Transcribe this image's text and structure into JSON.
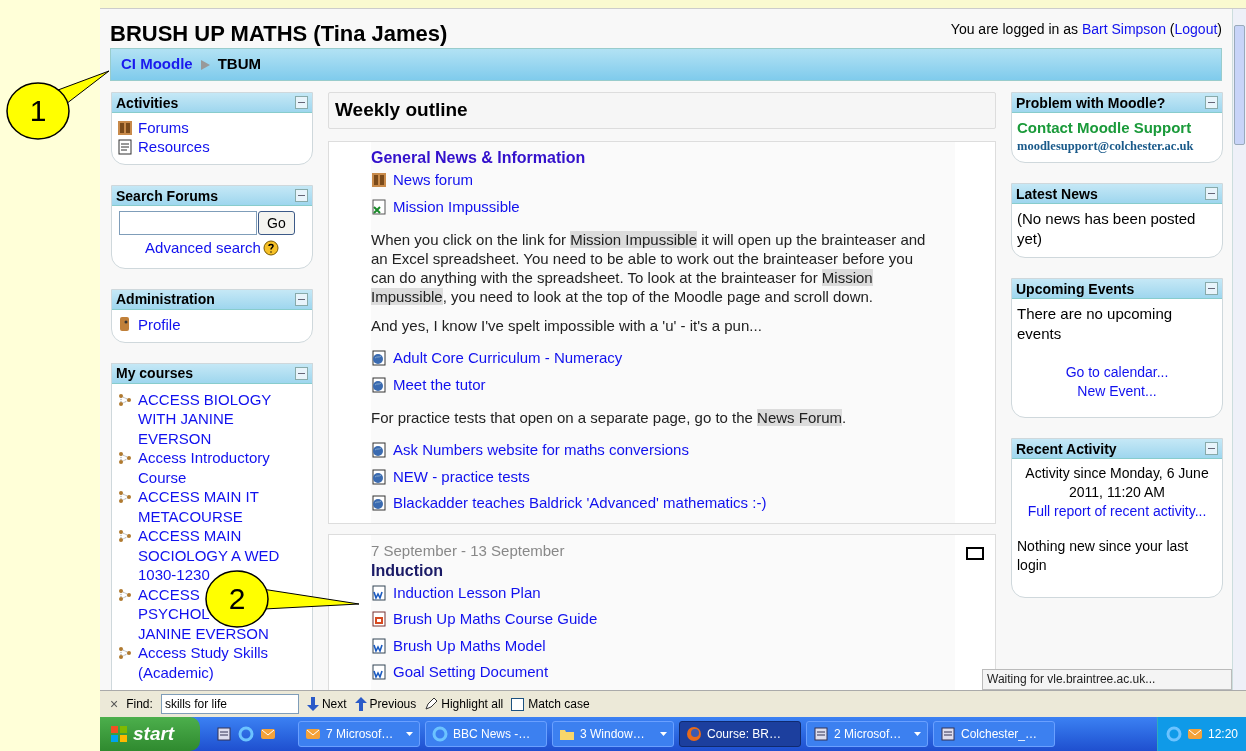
{
  "callouts": [
    {
      "label": "1"
    },
    {
      "label": "2"
    }
  ],
  "header": {
    "title": "BRUSH UP MATHS (Tina James)",
    "login": {
      "text_before": "You are logged in as",
      "user": "Bart Simpson",
      "paren_open": "(",
      "logout": "Logout",
      "paren_close": ")"
    },
    "breadcrumb": [
      "CI Moodle",
      "TBUM"
    ]
  },
  "left_blocks": [
    {
      "kind": "links",
      "title": "Activities",
      "items": [
        {
          "kind": "forum",
          "label": "Forums"
        },
        {
          "kind": "resource",
          "label": "Resources"
        }
      ]
    },
    {
      "kind": "search",
      "title": "Search Forums",
      "button": "Go",
      "link": "Advanced search"
    },
    {
      "kind": "links",
      "title": "Administration",
      "items": [
        {
          "kind": "profile",
          "label": "Profile"
        }
      ]
    },
    {
      "kind": "courses",
      "title": "My courses",
      "items": [
        {
          "lines": [
            "ACCESS BIOLOGY WITH JANINE EVERSON"
          ]
        },
        {
          "lines": [
            "Access Introductory Course"
          ]
        },
        {
          "lines": [
            "ACCESS MAIN IT METACOURSE"
          ]
        },
        {
          "lines": [
            "ACCESS MAIN SOCIOLOGY A WED 1030-1230"
          ]
        },
        {
          "lines": [
            "ACCESS",
            "PSYCHOL",
            "JANINE EVERSON"
          ]
        },
        {
          "lines": [
            "Access Study Skills (Academic)"
          ]
        }
      ]
    }
  ],
  "main": {
    "title": "Weekly outline",
    "sections": [
      {
        "kind": "topic",
        "title": "General News & Information",
        "highlight_marker": false,
        "items": [
          {
            "kind": "forum_link",
            "label": "News forum"
          },
          {
            "kind": "excel_link",
            "label": "Mission Impussible"
          },
          {
            "kind": "paragraph",
            "segments": [
              {
                "text": "When you click on the link for ",
                "highlight": false
              },
              {
                "text": "Mission Impussible",
                "highlight": true
              },
              {
                "text": " it will open up the brainteaser and an Excel spreadsheet. You need to be able to work out the brainteaser before you can do anything with the spreadsheet. To look at the brainteaser for ",
                "highlight": false
              },
              {
                "text": "Mission Impussible",
                "highlight": true
              },
              {
                "text": ", you need to look at the top of the Moodle page and scroll down.",
                "highlight": false
              }
            ]
          },
          {
            "kind": "paragraph",
            "segments": [
              {
                "text": "And yes, I know I've spelt impossible with a 'u' - it's a pun...",
                "highlight": false
              }
            ]
          },
          {
            "kind": "web_link",
            "label": "Adult Core Curriculum - Numeracy"
          },
          {
            "kind": "web_link",
            "label": "Meet the tutor"
          },
          {
            "kind": "paragraph",
            "segments": [
              {
                "text": "For practice tests that open on a separate page, go to the ",
                "highlight": false
              },
              {
                "text": "News Forum",
                "highlight": true
              },
              {
                "text": ".",
                "highlight": false
              }
            ]
          },
          {
            "kind": "web_link",
            "label": "Ask Numbers website for maths conversions"
          },
          {
            "kind": "web_link",
            "label": "NEW - practice tests"
          },
          {
            "kind": "web_link",
            "label": "Blackadder teaches Baldrick 'Advanced' mathematics :-)"
          }
        ]
      },
      {
        "kind": "week",
        "date": "7 September - 13 September",
        "title": "Induction",
        "highlight_marker": true,
        "items": [
          {
            "kind": "word_link",
            "label": "Induction Lesson Plan"
          },
          {
            "kind": "ppt_link",
            "label": "Brush Up Maths Course Guide"
          },
          {
            "kind": "word_link",
            "label": "Brush Up Maths Model"
          },
          {
            "kind": "word_link",
            "label": "Goal Setting Document"
          }
        ]
      }
    ]
  },
  "right_blocks": [
    {
      "kind": "support",
      "title": "Problem with Moodle?",
      "heading": "Contact Moodle Support",
      "email": "moodlesupport@colchester.ac.uk"
    },
    {
      "kind": "text",
      "title": "Latest News",
      "text": "(No news has been posted yet)"
    },
    {
      "kind": "events",
      "title": "Upcoming Events",
      "text": "There are no upcoming events",
      "links": [
        "Go to calendar...",
        "New Event..."
      ]
    },
    {
      "kind": "activity",
      "title": "Recent Activity",
      "since": "Activity since Monday, 6 June 2011, 11:20 AM",
      "link": "Full report of recent activity...",
      "text": "Nothing new since your last login"
    }
  ],
  "status_tooltip": "Waiting for vle.braintree.ac.uk...",
  "find_bar": {
    "close": "×",
    "label": "Find:",
    "value": "skills for life",
    "next": "Next",
    "previous": "Previous",
    "highlight": "Highlight all",
    "match_case": {
      "label": "Match case",
      "checked": false
    }
  },
  "taskbar": {
    "start": "start",
    "tasks": [
      {
        "kind": "mail",
        "label": "7 Microsof…",
        "group": true,
        "selected": false
      },
      {
        "kind": "browser",
        "label": "BBC News -…",
        "group": false,
        "selected": false
      },
      {
        "kind": "folder",
        "label": "3 Window…",
        "group": true,
        "selected": false
      },
      {
        "kind": "firefox",
        "label": "Course: BR…",
        "group": false,
        "selected": true
      },
      {
        "kind": "doc",
        "label": "2 Microsof…",
        "group": true,
        "selected": false
      },
      {
        "kind": "doc",
        "label": "Colchester_…",
        "group": false,
        "selected": false
      }
    ],
    "clock": "12:20"
  }
}
